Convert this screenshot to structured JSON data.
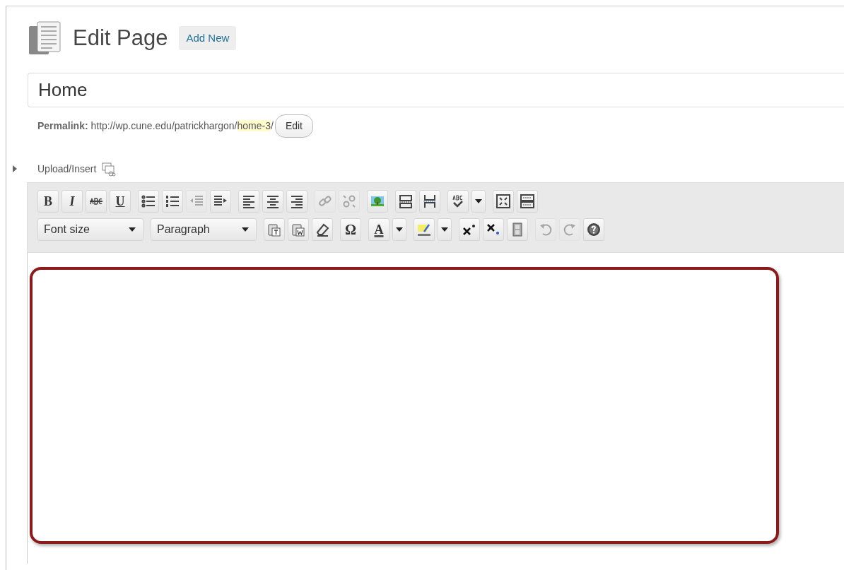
{
  "header": {
    "title": "Edit Page",
    "add_new": "Add New"
  },
  "title_field": {
    "value": "Home"
  },
  "permalink": {
    "label": "Permalink:",
    "url": "http://wp.cune.edu/patrickhargon/",
    "slug": "home-3",
    "trail": "/",
    "edit": "Edit"
  },
  "upload_insert": {
    "label": "Upload/Insert"
  },
  "toolbar": {
    "rows": [
      {
        "groups": [
          [
            {
              "kind": "bold",
              "glyph": "B",
              "disabled": false
            },
            {
              "kind": "italic",
              "glyph": "I",
              "disabled": false
            },
            {
              "kind": "strike",
              "disabled": false
            },
            {
              "kind": "underline",
              "glyph": "U",
              "disabled": false
            }
          ],
          [
            {
              "kind": "bullist",
              "disabled": false
            },
            {
              "kind": "numlist",
              "disabled": false
            },
            {
              "kind": "outdent",
              "disabled": true
            },
            {
              "kind": "indent",
              "disabled": false
            }
          ],
          [
            {
              "kind": "alignleft",
              "disabled": false
            },
            {
              "kind": "aligncenter",
              "disabled": false
            },
            {
              "kind": "alignright",
              "disabled": false
            }
          ],
          [
            {
              "kind": "link",
              "disabled": true
            },
            {
              "kind": "unlink",
              "disabled": true
            }
          ],
          [
            {
              "kind": "image",
              "disabled": false
            }
          ],
          [
            {
              "kind": "more",
              "disabled": false
            },
            {
              "kind": "pagebreak",
              "disabled": false
            }
          ],
          [
            {
              "kind": "spellcheck",
              "disabled": false
            }
          ],
          [
            {
              "kind": "fullscreen",
              "disabled": false
            },
            {
              "kind": "kitchensink",
              "disabled": false
            }
          ]
        ]
      },
      {
        "groups": [
          [
            {
              "kind": "select",
              "label": "Font size"
            }
          ],
          [
            {
              "kind": "select",
              "label": "Paragraph"
            }
          ],
          [
            {
              "kind": "pastetext",
              "disabled": false
            },
            {
              "kind": "pasteword",
              "disabled": false
            },
            {
              "kind": "eraser",
              "disabled": false
            }
          ],
          [
            {
              "kind": "charmap",
              "glyph": "Ω",
              "disabled": false
            }
          ],
          [
            {
              "kind": "forecolor",
              "glyph": "A",
              "disabled": false
            }
          ],
          [
            {
              "kind": "highlight",
              "disabled": false
            }
          ],
          [
            {
              "kind": "sup",
              "disabled": false
            },
            {
              "kind": "sub",
              "disabled": false
            },
            {
              "kind": "media",
              "disabled": false
            }
          ],
          [
            {
              "kind": "undo",
              "disabled": true
            },
            {
              "kind": "redo",
              "disabled": true
            },
            {
              "kind": "help",
              "disabled": false
            }
          ]
        ]
      }
    ]
  },
  "editor": {
    "highlighted": true
  }
}
